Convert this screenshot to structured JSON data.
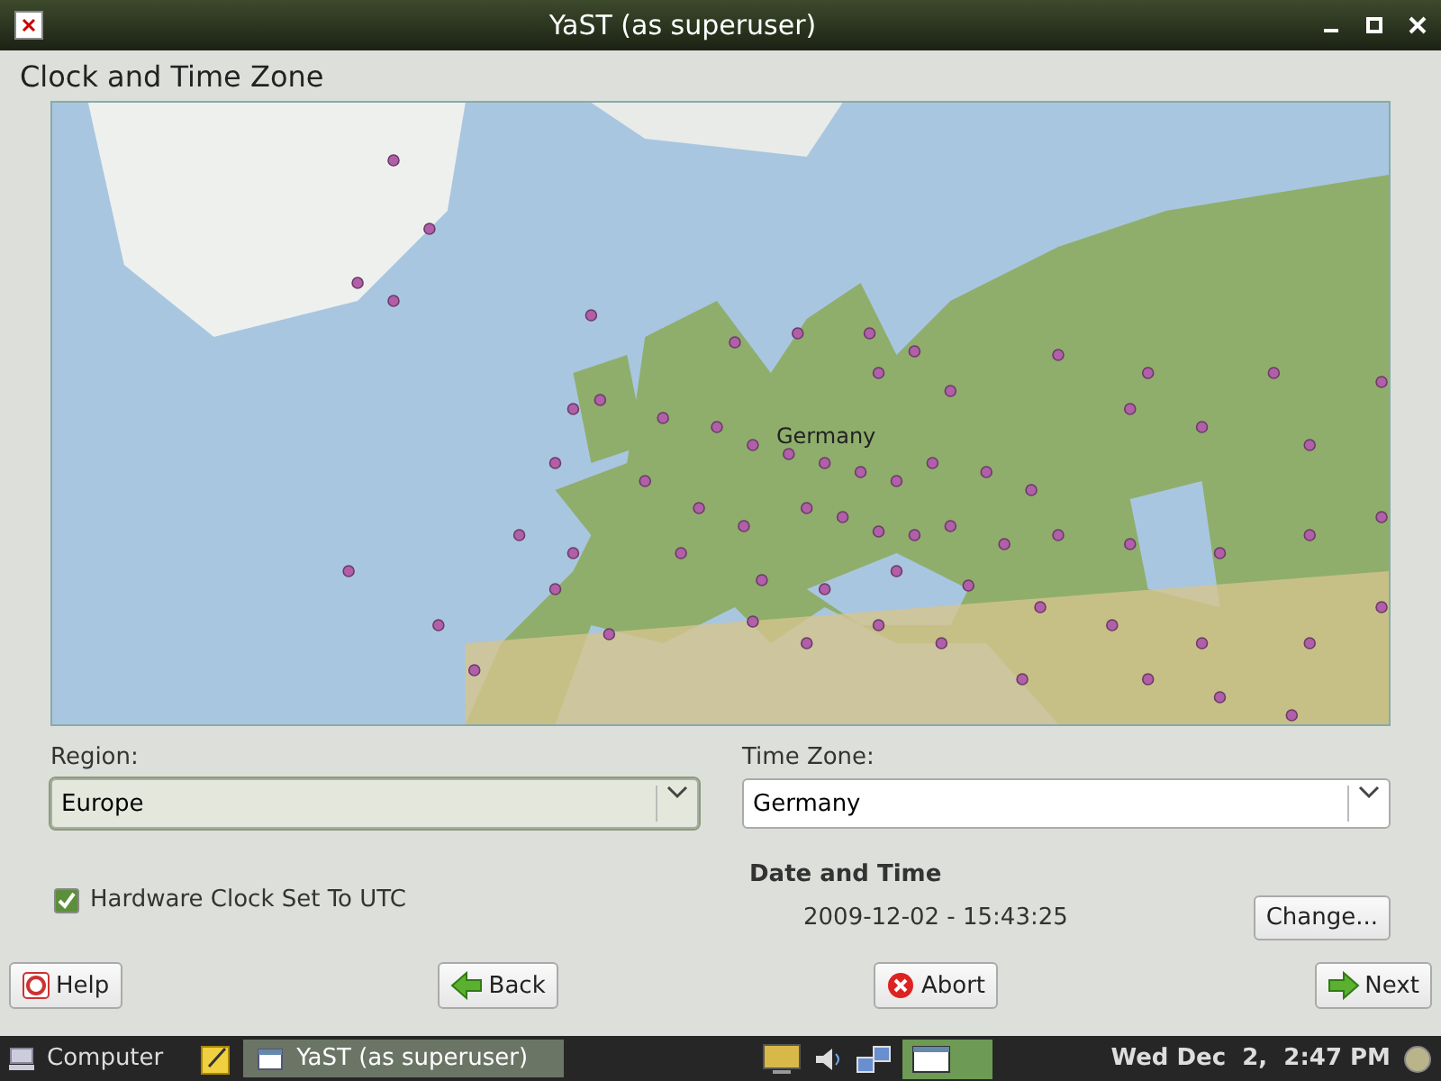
{
  "window": {
    "title": "YaST (as superuser)"
  },
  "heading": "Clock and Time Zone",
  "map": {
    "label": "Germany"
  },
  "region": {
    "label": "Region:",
    "value": "Europe"
  },
  "time_zone": {
    "label": "Time Zone:",
    "value": "Germany"
  },
  "hardware_clock": {
    "label": "Hardware Clock Set To UTC",
    "checked": true
  },
  "date_time": {
    "heading": "Date and Time",
    "value": "2009-12-02 - 15:43:25",
    "button": "Change..."
  },
  "buttons": [
    {
      "kind": "help",
      "label": "Help"
    },
    {
      "kind": "back",
      "label": "Back"
    },
    {
      "kind": "abort",
      "label": "Abort"
    },
    {
      "kind": "next",
      "label": "Next"
    }
  ],
  "taskbar": {
    "menu": "Computer",
    "task": "YaST (as superuser)",
    "clock": "Wed Dec  2,  2:47 PM"
  }
}
